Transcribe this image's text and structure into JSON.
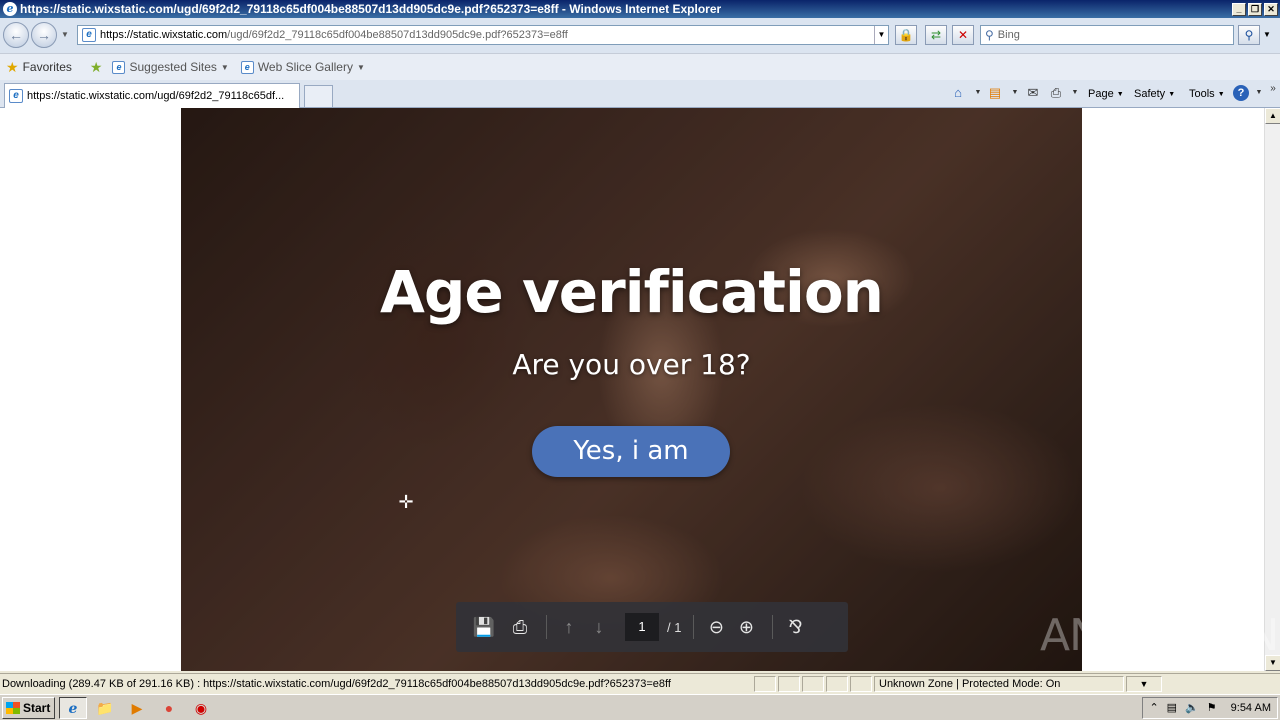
{
  "window": {
    "title": "https://static.wixstatic.com/ugd/69f2d2_79118c65df004be88507d13dd905dc9e.pdf?652373=e8ff - Windows Internet Explorer",
    "min": "_",
    "max": "❐",
    "close": "✕"
  },
  "addressbar": {
    "url_base": "https://static.wixstatic.com",
    "url_rest": "/ugd/69f2d2_79118c65df004be88507d13dd905dc9e.pdf?652373=e8ff",
    "search_placeholder": "Bing"
  },
  "favorites": {
    "favorites_label": "Favorites",
    "suggested_sites": "Suggested Sites",
    "web_slice_gallery": "Web Slice Gallery"
  },
  "tabs": [
    {
      "label": "https://static.wixstatic.com/ugd/69f2d2_79118c65df..."
    }
  ],
  "commandbar": {
    "page": "Page",
    "safety": "Safety",
    "tools": "Tools"
  },
  "pdf": {
    "heading": "Age verification",
    "question": "Are you over 18?",
    "button": "Yes, i am",
    "page_current": "1",
    "page_total": "/ 1"
  },
  "watermark": "ANY ▷ RUN",
  "status": {
    "message": "Downloading (289.47 KB of 291.16 KB) : https://static.wixstatic.com/ugd/69f2d2_79118c65df004be88507d13dd905dc9e.pdf?652373=e8ff",
    "zone": "Unknown Zone | Protected Mode: On"
  },
  "taskbar": {
    "start": "Start",
    "clock": "9:54 AM"
  }
}
